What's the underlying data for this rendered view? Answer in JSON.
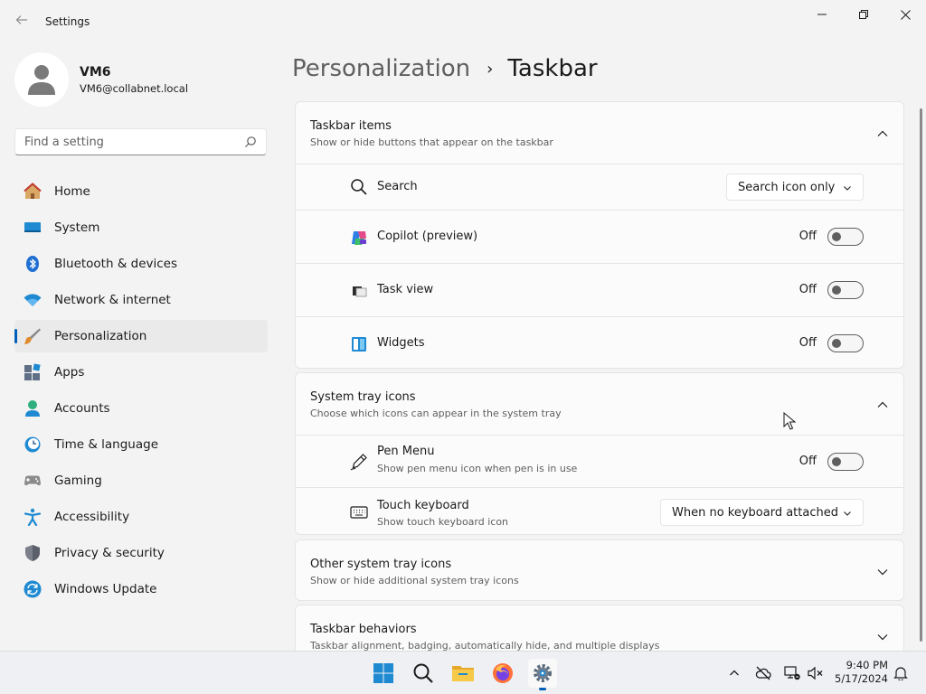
{
  "window": {
    "title": "Settings"
  },
  "profile": {
    "name": "VM6",
    "email": "VM6@collabnet.local"
  },
  "search": {
    "placeholder": "Find a setting"
  },
  "nav": {
    "items": [
      {
        "label": "Home",
        "icon": "home-icon"
      },
      {
        "label": "System",
        "icon": "system-icon"
      },
      {
        "label": "Bluetooth & devices",
        "icon": "bluetooth-icon"
      },
      {
        "label": "Network & internet",
        "icon": "wifi-icon"
      },
      {
        "label": "Personalization",
        "icon": "brush-icon",
        "selected": true
      },
      {
        "label": "Apps",
        "icon": "apps-icon"
      },
      {
        "label": "Accounts",
        "icon": "accounts-icon"
      },
      {
        "label": "Time & language",
        "icon": "clock-icon"
      },
      {
        "label": "Gaming",
        "icon": "gamepad-icon"
      },
      {
        "label": "Accessibility",
        "icon": "accessibility-icon"
      },
      {
        "label": "Privacy & security",
        "icon": "shield-icon"
      },
      {
        "label": "Windows Update",
        "icon": "update-icon"
      }
    ]
  },
  "breadcrumb": {
    "parent": "Personalization",
    "separator": "›",
    "current": "Taskbar"
  },
  "taskbar_items": {
    "title": "Taskbar items",
    "subtitle": "Show or hide buttons that appear on the taskbar",
    "search": {
      "label": "Search",
      "value": "Search icon only"
    },
    "copilot": {
      "label": "Copilot (preview)",
      "state": "Off"
    },
    "taskview": {
      "label": "Task view",
      "state": "Off"
    },
    "widgets": {
      "label": "Widgets",
      "state": "Off"
    }
  },
  "tray_icons": {
    "title": "System tray icons",
    "subtitle": "Choose which icons can appear in the system tray",
    "pen": {
      "label": "Pen Menu",
      "sub": "Show pen menu icon when pen is in use",
      "state": "Off"
    },
    "touch": {
      "label": "Touch keyboard",
      "sub": "Show touch keyboard icon",
      "value": "When no keyboard attached"
    }
  },
  "other_tray": {
    "title": "Other system tray icons",
    "subtitle": "Show or hide additional system tray icons"
  },
  "behaviors": {
    "title": "Taskbar behaviors",
    "subtitle": "Taskbar alignment, badging, automatically hide, and multiple displays"
  },
  "clock": {
    "time": "9:40 PM",
    "date": "5/17/2024"
  },
  "colors": {
    "accent": "#005fb8",
    "background": "#f3f3f3",
    "card": "#fbfbfb"
  }
}
